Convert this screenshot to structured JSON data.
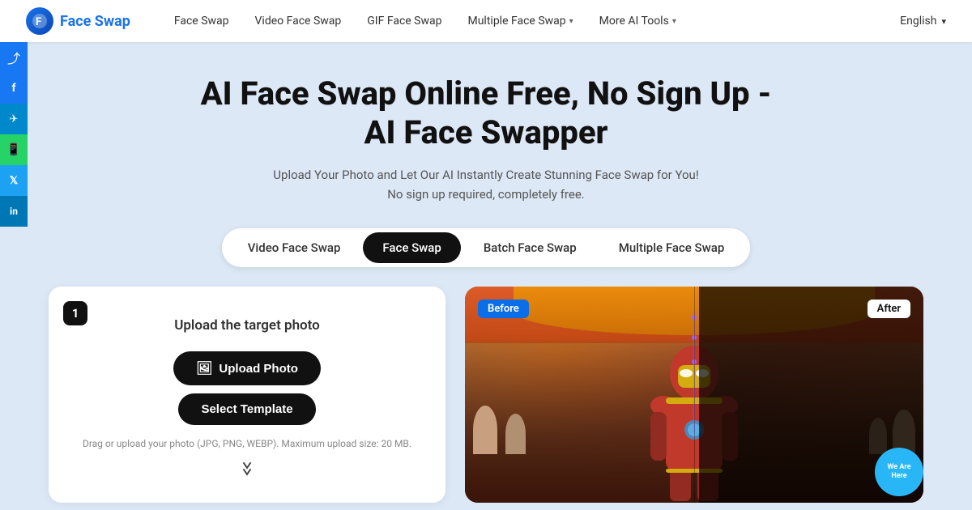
{
  "logo": {
    "icon": "F",
    "text": "Face Swap",
    "href": "#"
  },
  "nav": {
    "links": [
      {
        "label": "Face Swap",
        "hasDropdown": false
      },
      {
        "label": "Video Face Swap",
        "hasDropdown": false
      },
      {
        "label": "GIF Face Swap",
        "hasDropdown": false
      },
      {
        "label": "Multiple Face Swap",
        "hasDropdown": true
      },
      {
        "label": "More AI Tools",
        "hasDropdown": true
      }
    ],
    "language": "English"
  },
  "social": [
    {
      "name": "share",
      "icon": "⤴",
      "class": "share"
    },
    {
      "name": "facebook",
      "icon": "f",
      "class": "facebook"
    },
    {
      "name": "telegram",
      "icon": "✈",
      "class": "telegram"
    },
    {
      "name": "whatsapp",
      "icon": "📞",
      "class": "whatsapp"
    },
    {
      "name": "twitter",
      "icon": "𝕏",
      "class": "twitter"
    },
    {
      "name": "linkedin",
      "icon": "in",
      "class": "linkedin"
    }
  ],
  "hero": {
    "title": "AI Face Swap Online Free, No Sign Up -\nAI Face Swapper",
    "subtitle": "Upload Your Photo and Let Our AI Instantly Create Stunning Face Swap for You!\nNo sign up required, completely free."
  },
  "tabs": [
    {
      "label": "Video Face Swap",
      "active": false
    },
    {
      "label": "Face Swap",
      "active": true
    },
    {
      "label": "Batch Face Swap",
      "active": false
    },
    {
      "label": "Multiple Face Swap",
      "active": false
    }
  ],
  "upload": {
    "step": "1",
    "title": "Upload the target photo",
    "uploadBtn": "Upload Photo",
    "templateBtn": "Select Template",
    "hint": "Drag or upload your photo (JPG, PNG, WEBP). Maximum upload size: 20 MB."
  },
  "preview": {
    "beforeLabel": "Before",
    "afterLabel": "After",
    "watermark": "Are Here"
  }
}
